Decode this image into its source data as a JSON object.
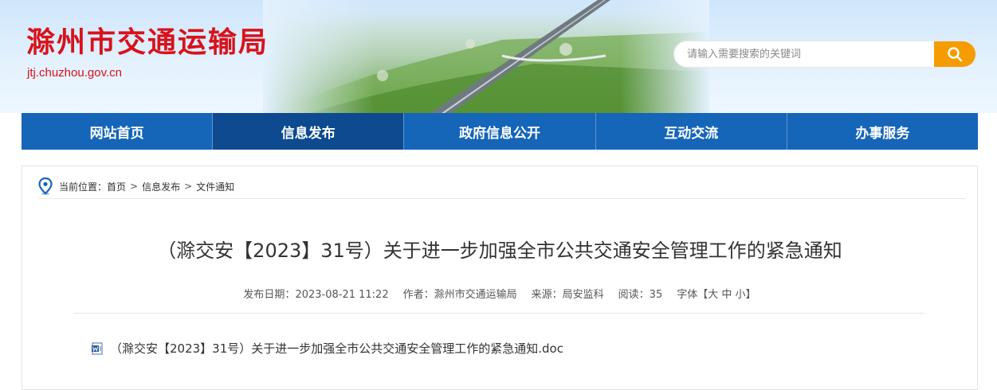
{
  "header": {
    "site_title": "滁州市交通运输局",
    "site_url": "jtj.chuzhou.gov.cn",
    "search_placeholder": "请输入需要搜索的关键词"
  },
  "nav": {
    "items": [
      {
        "label": "网站首页"
      },
      {
        "label": "信息发布"
      },
      {
        "label": "政府信息公开"
      },
      {
        "label": "互动交流"
      },
      {
        "label": "办事服务"
      }
    ],
    "active_index": 1
  },
  "breadcrumb": {
    "prefix": "当前位置：",
    "items": [
      "首页",
      "信息发布",
      "文件通知"
    ],
    "separator": ">"
  },
  "article": {
    "title": "（滁交安【2023】31号）关于进一步加强全市公共交通安全管理工作的紧急通知",
    "meta": {
      "publish_label": "发布日期：",
      "publish_date": "2023-08-21 11:22",
      "author_label": "作者：",
      "author": "滁州市交通运输局",
      "source_label": "来源：",
      "source": "局安监科",
      "reads_label": "阅读：",
      "reads": "35",
      "font_label": "字体【",
      "font_large": "大",
      "font_medium": "中",
      "font_small": "小",
      "font_close": "】"
    },
    "attachment": "（滁交安【2023】31号）关于进一步加强全市公共交通安全管理工作的紧急通知.doc"
  },
  "colors": {
    "brand_red": "#d8121b",
    "nav_blue": "#1565b8",
    "nav_active": "#0d4a8f",
    "search_orange": "#f59c00"
  },
  "icons": {
    "search": "search-icon",
    "location": "location-pin-icon",
    "attachment": "word-doc-icon"
  }
}
